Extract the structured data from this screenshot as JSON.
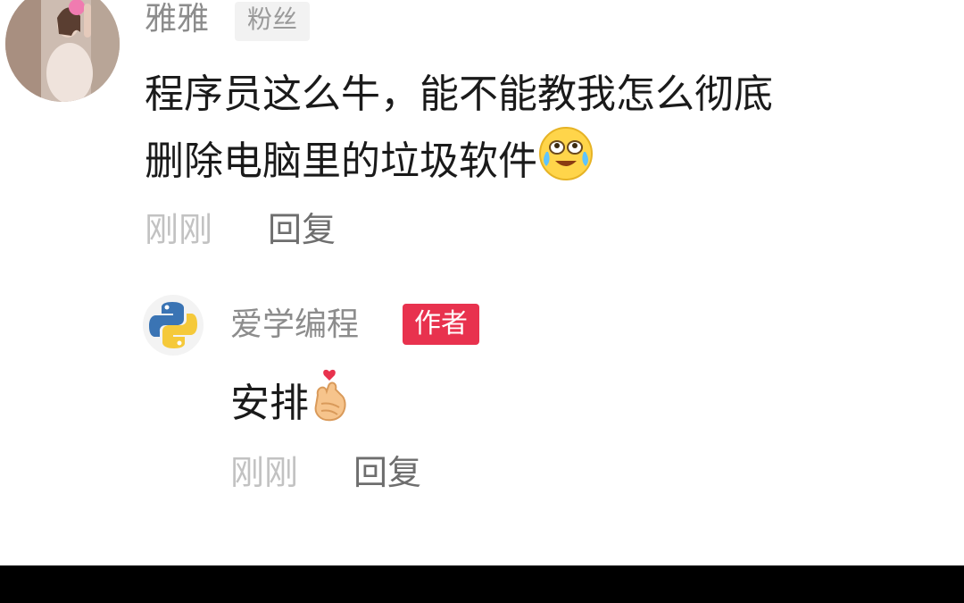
{
  "comment": {
    "username": "雅雅",
    "badge": "粉丝",
    "text_line1": "程序员这么牛，能不能教我怎么彻底",
    "text_line2": "删除电脑里的垃圾软件",
    "emoji": "crying-laughing-emoji",
    "time": "刚刚",
    "reply_label": "回复"
  },
  "reply": {
    "username": "爱学编程",
    "badge": "作者",
    "text": "安排",
    "emoji": "finger-heart-emoji",
    "time": "刚刚",
    "reply_label": "回复"
  },
  "colors": {
    "author_badge": "#e8324e",
    "fan_badge_bg": "#f2f2f2",
    "username": "#8c8c8c",
    "time": "#c2c2c2",
    "reply": "#6e6e6e"
  }
}
